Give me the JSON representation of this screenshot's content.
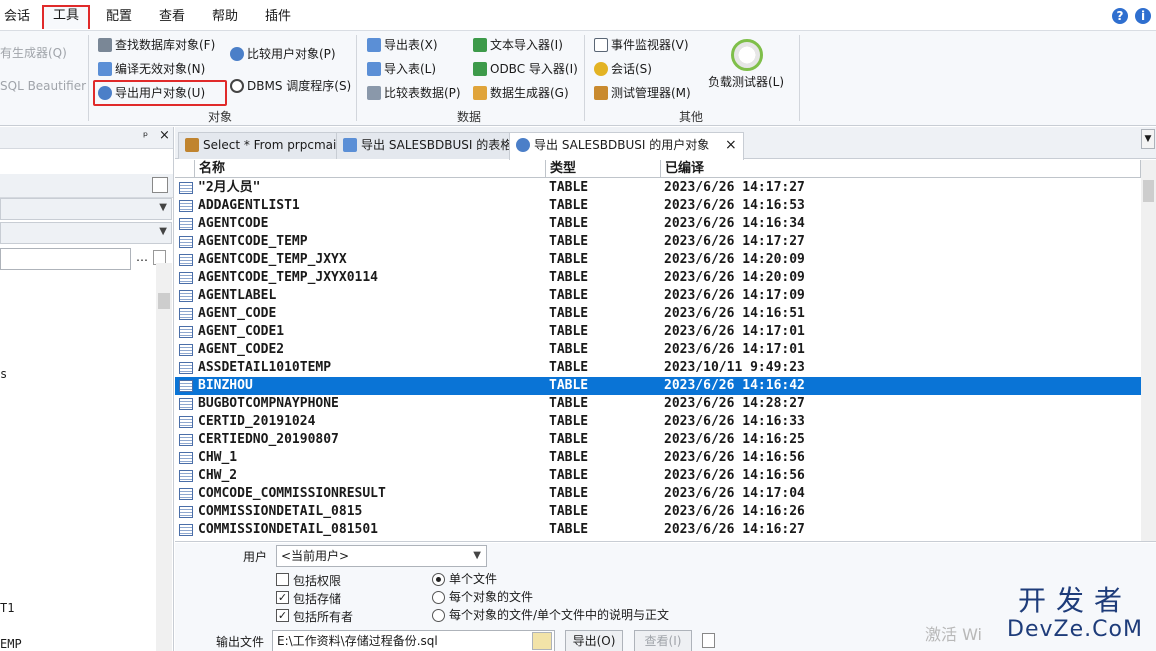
{
  "menubar": {
    "items": [
      "会话",
      "工具",
      "配置",
      "查看",
      "帮助",
      "插件"
    ],
    "active_index": 1,
    "help_icon": "?",
    "info_icon": "i"
  },
  "ribbon": {
    "left_fragments": [
      "有生成器(Q)",
      "SQL Beautifier"
    ],
    "objects": {
      "items": [
        "查找数据库对象(F)",
        "编译无效对象(N)",
        "导出用户对象(U)",
        "比较用户对象(P)",
        "DBMS 调度程序(S)"
      ],
      "label": "对象"
    },
    "data": {
      "items": [
        "导出表(X)",
        "导入表(L)",
        "比较表数据(P)",
        "文本导入器(I)",
        "ODBC 导入器(I)",
        "数据生成器(G)"
      ],
      "label": "数据"
    },
    "other": {
      "items": [
        "事件监视器(V)",
        "会话(S)",
        "测试管理器(M)",
        "负载测试器(L)"
      ],
      "label": "其他"
    }
  },
  "left_panel": {
    "pin_glyph": "ᵖ",
    "close_glyph": "×",
    "browse_glyph": "…",
    "fragments": [
      "s",
      "T1",
      "EMP"
    ]
  },
  "tabs": [
    {
      "label": "Select * From prpcmain",
      "active": false
    },
    {
      "label": "导出 SALESBDBUSI 的表格",
      "active": false
    },
    {
      "label": "导出 SALESBDBUSI 的用户对象",
      "active": true
    }
  ],
  "tab_close": "×",
  "grid": {
    "columns": [
      "名称",
      "类型",
      "已编译"
    ],
    "rows": [
      {
        "name": "\"2月人员\"",
        "type": "TABLE",
        "compiled": "2023/6/26 14:17:27"
      },
      {
        "name": "ADDAGENTLIST1",
        "type": "TABLE",
        "compiled": "2023/6/26 14:16:53"
      },
      {
        "name": "AGENTCODE",
        "type": "TABLE",
        "compiled": "2023/6/26 14:16:34"
      },
      {
        "name": "AGENTCODE_TEMP",
        "type": "TABLE",
        "compiled": "2023/6/26 14:17:27"
      },
      {
        "name": "AGENTCODE_TEMP_JXYX",
        "type": "TABLE",
        "compiled": "2023/6/26 14:20:09"
      },
      {
        "name": "AGENTCODE_TEMP_JXYX0114",
        "type": "TABLE",
        "compiled": "2023/6/26 14:20:09"
      },
      {
        "name": "AGENTLABEL",
        "type": "TABLE",
        "compiled": "2023/6/26 14:17:09"
      },
      {
        "name": "AGENT_CODE",
        "type": "TABLE",
        "compiled": "2023/6/26 14:16:51"
      },
      {
        "name": "AGENT_CODE1",
        "type": "TABLE",
        "compiled": "2023/6/26 14:17:01"
      },
      {
        "name": "AGENT_CODE2",
        "type": "TABLE",
        "compiled": "2023/6/26 14:17:01"
      },
      {
        "name": "ASSDETAIL1010TEMP",
        "type": "TABLE",
        "compiled": "2023/10/11 9:49:23"
      },
      {
        "name": "BINZHOU",
        "type": "TABLE",
        "compiled": "2023/6/26 14:16:42"
      },
      {
        "name": "BUGBOTCOMPNAYPHONE",
        "type": "TABLE",
        "compiled": "2023/6/26 14:28:27"
      },
      {
        "name": "CERTID_20191024",
        "type": "TABLE",
        "compiled": "2023/6/26 14:16:33"
      },
      {
        "name": "CERTIEDNO_20190807",
        "type": "TABLE",
        "compiled": "2023/6/26 14:16:25"
      },
      {
        "name": "CHW_1",
        "type": "TABLE",
        "compiled": "2023/6/26 14:16:56"
      },
      {
        "name": "CHW_2",
        "type": "TABLE",
        "compiled": "2023/6/26 14:16:56"
      },
      {
        "name": "COMCODE_COMMISSIONRESULT",
        "type": "TABLE",
        "compiled": "2023/6/26 14:17:04"
      },
      {
        "name": "COMMISSIONDETAIL_0815",
        "type": "TABLE",
        "compiled": "2023/6/26 14:16:26"
      },
      {
        "name": "COMMISSIONDETAIL_081501",
        "type": "TABLE",
        "compiled": "2023/6/26 14:16:27"
      }
    ],
    "selected_index": 11
  },
  "options": {
    "user_label": "用户",
    "user_value": "<当前用户>",
    "checkboxes": [
      {
        "label": "包括权限",
        "checked": false
      },
      {
        "label": "包括存储",
        "checked": true
      },
      {
        "label": "包括所有者",
        "checked": true
      }
    ],
    "radios": [
      {
        "label": "单个文件",
        "checked": true
      },
      {
        "label": "每个对象的文件",
        "checked": false
      },
      {
        "label": "每个对象的文件/单个文件中的说明与正文",
        "checked": false
      }
    ],
    "output_label": "输出文件",
    "output_value": "E:\\工作资料\\存储过程备份.sql",
    "export_button": "导出(O)",
    "view_button": "查看(I)"
  },
  "watermark": {
    "activate_text": "激活 Wi",
    "logo_top": "开发者",
    "logo_bottom": "DevZe.CoM"
  },
  "colors": {
    "selection": "#0a74d6",
    "highlight_border": "#e02a2a"
  }
}
